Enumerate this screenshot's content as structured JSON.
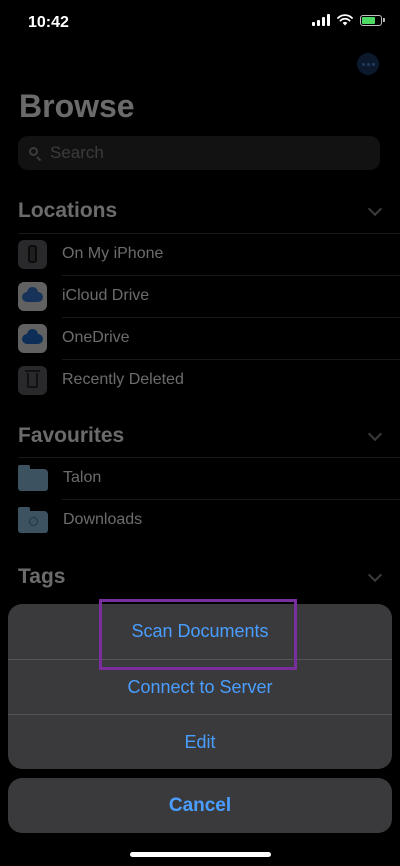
{
  "status_bar": {
    "time": "10:42"
  },
  "browse": {
    "title": "Browse",
    "search_placeholder": "Search"
  },
  "locations": {
    "header": "Locations",
    "items": [
      {
        "label": "On My iPhone",
        "icon": "phone-icon"
      },
      {
        "label": "iCloud Drive",
        "icon": "icloud-icon"
      },
      {
        "label": "OneDrive",
        "icon": "onedrive-icon"
      },
      {
        "label": "Recently Deleted",
        "icon": "trash-icon"
      }
    ]
  },
  "favourites": {
    "header": "Favourites",
    "items": [
      {
        "label": "Talon",
        "icon": "folder-icon"
      },
      {
        "label": "Downloads",
        "icon": "downloads-folder-icon"
      }
    ]
  },
  "tags": {
    "header": "Tags"
  },
  "action_sheet": {
    "actions": [
      {
        "label": "Scan Documents"
      },
      {
        "label": "Connect to Server"
      },
      {
        "label": "Edit"
      }
    ],
    "cancel_label": "Cancel"
  },
  "colors": {
    "accent": "#4a9eff",
    "highlight_border": "#7a2d9c",
    "sheet_background": "#3a3a3c"
  }
}
